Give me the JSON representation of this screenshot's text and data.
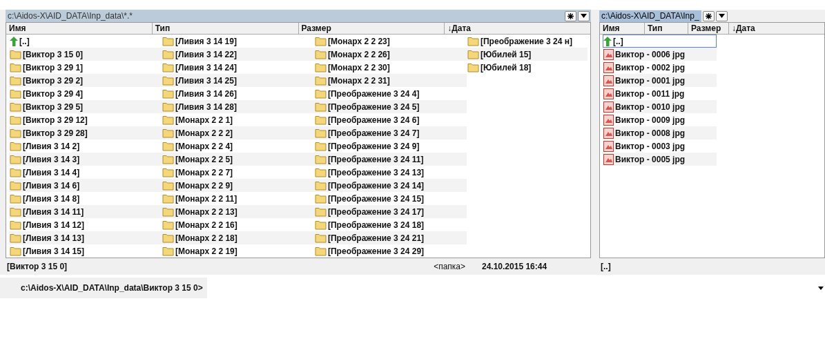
{
  "panels": [
    {
      "path": "c:\\Aidos-X\\AID_DATA\\Inp_data\\*.*",
      "active": false,
      "columns": [
        "Имя",
        "Тип",
        "Размер",
        "↓Дата"
      ],
      "items": [
        {
          "kind": "parent",
          "name": "[..]",
          "selected": false
        },
        {
          "kind": "folder",
          "name": "[Виктор 3 15 0]",
          "selected": false
        },
        {
          "kind": "folder",
          "name": "[Виктор 3 29 1]",
          "selected": false
        },
        {
          "kind": "folder",
          "name": "[Виктор 3 29 2]",
          "selected": false
        },
        {
          "kind": "folder",
          "name": "[Виктор 3 29 4]",
          "selected": false
        },
        {
          "kind": "folder",
          "name": "[Виктор 3 29 5]",
          "selected": false
        },
        {
          "kind": "folder",
          "name": "[Виктор 3 29 12]",
          "selected": false
        },
        {
          "kind": "folder",
          "name": "[Виктор 3 29 28]",
          "selected": false
        },
        {
          "kind": "folder",
          "name": "[Ливия 3 14 2]",
          "selected": false
        },
        {
          "kind": "folder",
          "name": "[Ливия 3 14 3]",
          "selected": false
        },
        {
          "kind": "folder",
          "name": "[Ливия 3 14 4]",
          "selected": false
        },
        {
          "kind": "folder",
          "name": "[Ливия 3 14 6]",
          "selected": false
        },
        {
          "kind": "folder",
          "name": "[Ливия 3 14 8]",
          "selected": false
        },
        {
          "kind": "folder",
          "name": "[Ливия 3 14 11]",
          "selected": false
        },
        {
          "kind": "folder",
          "name": "[Ливия 3 14 12]",
          "selected": false
        },
        {
          "kind": "folder",
          "name": "[Ливия 3 14 13]",
          "selected": false
        },
        {
          "kind": "folder",
          "name": "[Ливия 3 14 15]",
          "selected": false
        },
        {
          "kind": "folder",
          "name": "[Ливия 3 14 19]",
          "selected": false
        },
        {
          "kind": "folder",
          "name": "[Ливия 3 14 22]",
          "selected": false
        },
        {
          "kind": "folder",
          "name": "[Ливия 3 14 24]",
          "selected": false
        },
        {
          "kind": "folder",
          "name": "[Ливия 3 14 25]",
          "selected": false
        },
        {
          "kind": "folder",
          "name": "[Ливия 3 14 26]",
          "selected": false
        },
        {
          "kind": "folder",
          "name": "[Ливия 3 14 28]",
          "selected": false
        },
        {
          "kind": "folder",
          "name": "[Монарх 2 2 1]",
          "selected": false
        },
        {
          "kind": "folder",
          "name": "[Монарх 2 2 2]",
          "selected": false
        },
        {
          "kind": "folder",
          "name": "[Монарх 2 2 4]",
          "selected": false
        },
        {
          "kind": "folder",
          "name": "[Монарх 2 2 5]",
          "selected": false
        },
        {
          "kind": "folder",
          "name": "[Монарх 2 2 7]",
          "selected": false
        },
        {
          "kind": "folder",
          "name": "[Монарх 2 2 9]",
          "selected": false
        },
        {
          "kind": "folder",
          "name": "[Монарх 2 2 11]",
          "selected": false
        },
        {
          "kind": "folder",
          "name": "[Монарх 2 2 13]",
          "selected": false
        },
        {
          "kind": "folder",
          "name": "[Монарх 2 2 16]",
          "selected": false
        },
        {
          "kind": "folder",
          "name": "[Монарх 2 2 18]",
          "selected": false
        },
        {
          "kind": "folder",
          "name": "[Монарх 2 2 19]",
          "selected": false
        },
        {
          "kind": "folder",
          "name": "[Монарх 2 2 23]",
          "selected": false
        },
        {
          "kind": "folder",
          "name": "[Монарх 2 2 26]",
          "selected": false
        },
        {
          "kind": "folder",
          "name": "[Монарх 2 2 30]",
          "selected": false
        },
        {
          "kind": "folder",
          "name": "[Монарх 2 2 31]",
          "selected": false
        },
        {
          "kind": "folder",
          "name": "[Преображение 3 24 4]",
          "selected": false
        },
        {
          "kind": "folder",
          "name": "[Преображение 3 24 5]",
          "selected": false
        },
        {
          "kind": "folder",
          "name": "[Преображение 3 24 6]",
          "selected": false
        },
        {
          "kind": "folder",
          "name": "[Преображение 3 24 7]",
          "selected": false
        },
        {
          "kind": "folder",
          "name": "[Преображение 3 24 9]",
          "selected": false
        },
        {
          "kind": "folder",
          "name": "[Преображение 3 24 11]",
          "selected": false
        },
        {
          "kind": "folder",
          "name": "[Преображение 3 24 13]",
          "selected": false
        },
        {
          "kind": "folder",
          "name": "[Преображение 3 24 14]",
          "selected": false
        },
        {
          "kind": "folder",
          "name": "[Преображение 3 24 15]",
          "selected": false
        },
        {
          "kind": "folder",
          "name": "[Преображение 3 24 17]",
          "selected": false
        },
        {
          "kind": "folder",
          "name": "[Преображение 3 24 18]",
          "selected": false
        },
        {
          "kind": "folder",
          "name": "[Преображение 3 24 21]",
          "selected": false
        },
        {
          "kind": "folder",
          "name": "[Преображение 3 24 29]",
          "selected": false
        },
        {
          "kind": "folder",
          "name": "[Преображение 3 24 н]",
          "selected": false
        },
        {
          "kind": "folder",
          "name": "[Юбилей 15]",
          "selected": false
        },
        {
          "kind": "folder",
          "name": "[Юбилей 18]",
          "selected": false
        }
      ],
      "status": [
        "[Виктор 3 15 0]",
        "<папка>",
        "24.10.2015 16:44"
      ]
    },
    {
      "path": "c:\\Aidos-X\\AID_DATA\\Inp_",
      "active": true,
      "columns": [
        "Имя",
        "Тип",
        "Размер",
        "↓Дата"
      ],
      "items": [
        {
          "kind": "parent",
          "name": "[..]",
          "selected": true
        },
        {
          "kind": "image",
          "name": "Виктор - 0006 jpg",
          "selected": false
        },
        {
          "kind": "image",
          "name": "Виктор - 0002 jpg",
          "selected": false
        },
        {
          "kind": "image",
          "name": "Виктор - 0001 jpg",
          "selected": false
        },
        {
          "kind": "image",
          "name": "Виктор - 0011 jpg",
          "selected": false
        },
        {
          "kind": "image",
          "name": "Виктор - 0010 jpg",
          "selected": false
        },
        {
          "kind": "image",
          "name": "Виктор - 0009 jpg",
          "selected": false
        },
        {
          "kind": "image",
          "name": "Виктор - 0008 jpg",
          "selected": false
        },
        {
          "kind": "image",
          "name": "Виктор - 0003 jpg",
          "selected": false
        },
        {
          "kind": "image",
          "name": "Виктор - 0005 jpg",
          "selected": false
        }
      ],
      "status": [
        "[..]"
      ]
    }
  ],
  "command_line": {
    "prompt": "c:\\Aidos-X\\AID_DATA\\Inp_data\\Виктор 3 15 0>"
  }
}
